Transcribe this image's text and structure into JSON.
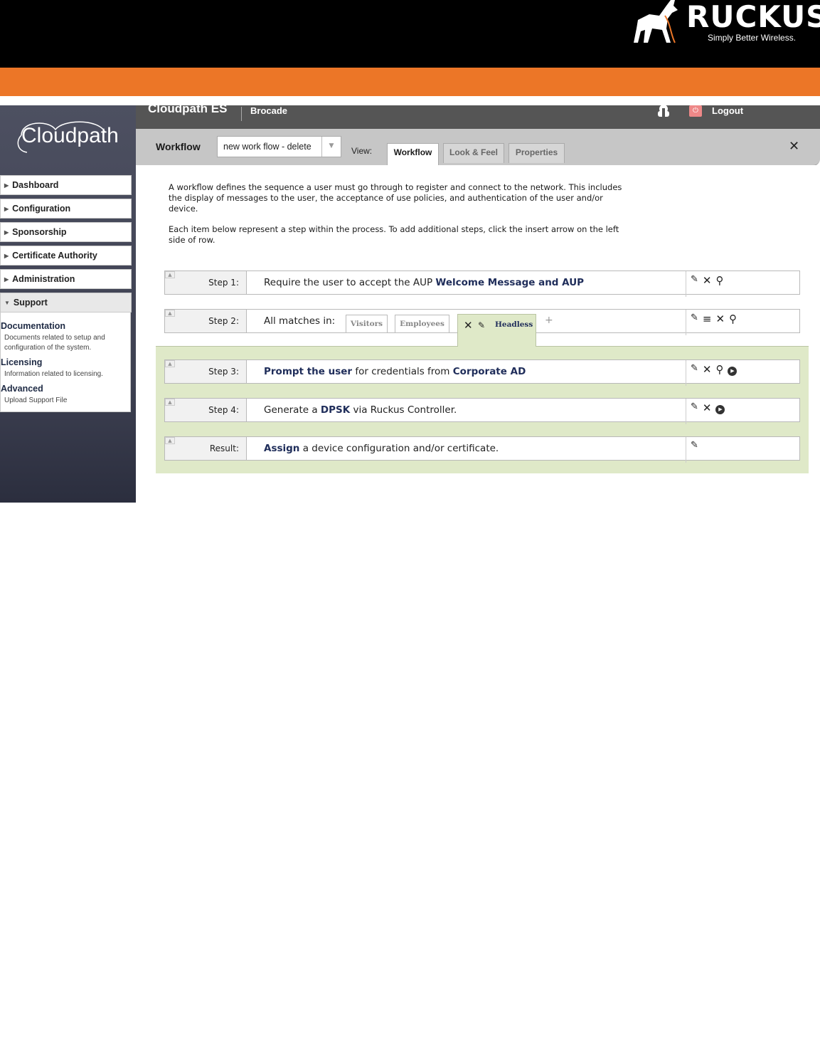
{
  "brand": {
    "name": "RUCKUS",
    "tagline": "Simply Better Wireless."
  },
  "app": {
    "product": "Cloudpath ES",
    "logo": "Cloudpath",
    "org": "Brocade",
    "logout": "Logout"
  },
  "sidebar": {
    "items": [
      {
        "label": "Dashboard"
      },
      {
        "label": "Configuration"
      },
      {
        "label": "Sponsorship"
      },
      {
        "label": "Certificate Authority"
      },
      {
        "label": "Administration"
      },
      {
        "label": "Support"
      }
    ],
    "support_links": [
      {
        "title": "Documentation",
        "desc": "Documents related to setup and configuration of the system."
      },
      {
        "title": "Licensing",
        "desc": "Information related to licensing."
      },
      {
        "title": "Advanced",
        "desc": "Upload Support File"
      }
    ]
  },
  "workflow_bar": {
    "label": "Workflow",
    "selected": "new work flow - delete",
    "view_label": "View:",
    "tabs": [
      "Workflow",
      "Look & Feel",
      "Properties"
    ],
    "active_tab": "Workflow"
  },
  "description": {
    "p1": "A workflow defines the sequence a user must go through to register and connect to the network. This includes the display of messages to the user, the acceptance of use policies, and authentication of the user and/or device.",
    "p2": "Each item below represent a step within the process. To add additional steps, click the insert arrow on the left side of row."
  },
  "steps": [
    {
      "label": "Step 1:",
      "text_pre": "Require the user to accept the AUP ",
      "text_bold": "Welcome Message and AUP"
    },
    {
      "label": "Step 2:",
      "text_pre": "All matches in:",
      "matches": [
        "Visitors",
        "Employees",
        "Headless"
      ],
      "active_match": "Headless"
    },
    {
      "label": "Step 3:",
      "bold1": "Prompt the user",
      "mid": " for credentials from ",
      "bold2": "Corporate AD"
    },
    {
      "label": "Step 4:",
      "pre": "Generate a ",
      "bold": "DPSK",
      "post": " via Ruckus Controller."
    },
    {
      "label": "Result:",
      "bold": "Assign",
      "post": " a device configuration and/or certificate."
    }
  ],
  "colors": {
    "orange": "#ec7627",
    "green_area": "#dfe9c8",
    "link_navy": "#1f2d5a"
  }
}
